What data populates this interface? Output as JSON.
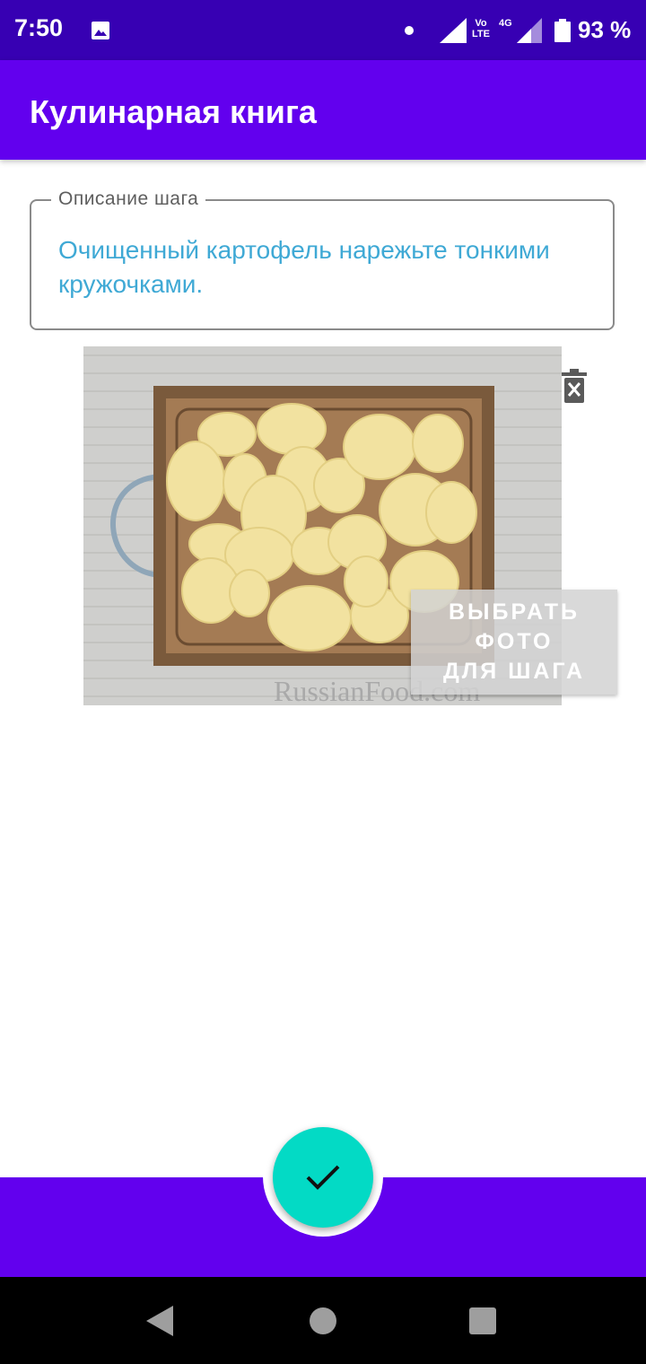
{
  "status_bar": {
    "time": "7:50",
    "volte_line1": "Vo",
    "volte_line2": "LTE",
    "network": "4G",
    "battery": "93 %"
  },
  "app_bar": {
    "title": "Кулинарная книга"
  },
  "step": {
    "description_label": "Описание шага",
    "description_value": "Очищенный картофель нарежьте тонкими кружочками.",
    "photo_watermark": "RussianFood.com",
    "pick_photo_line1": "ВЫБРАТЬ",
    "pick_photo_line2": "ФОТО",
    "pick_photo_line3": "ДЛЯ ШАГА"
  },
  "colors": {
    "status_bar": "#3700b3",
    "primary": "#6200ee",
    "fab": "#03dac5",
    "description_text": "#3fa9d5"
  },
  "icons": {
    "fab": "check-icon",
    "photo_delete": "delete-icon",
    "nav": [
      "back-icon",
      "home-icon",
      "recents-icon"
    ]
  }
}
